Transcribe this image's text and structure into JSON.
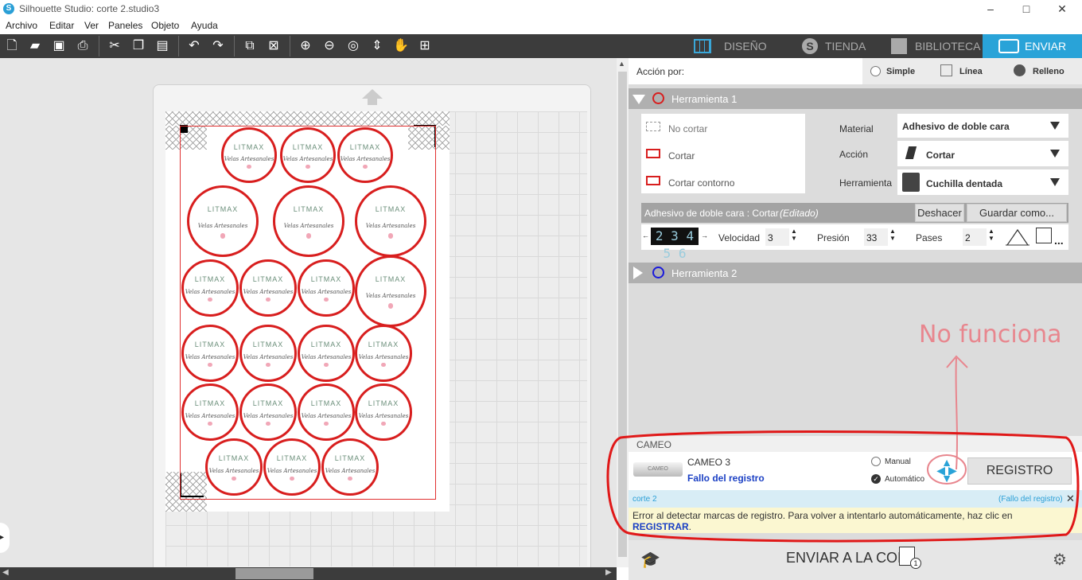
{
  "window": {
    "title": "Silhouette Studio: corte 2.studio3",
    "minimize": "–",
    "maximize": "□",
    "close": "✕"
  },
  "menu": [
    "Archivo",
    "Editar",
    "Ver",
    "Paneles",
    "Objeto",
    "Ayuda"
  ],
  "tabs": [
    {
      "label": "DISEÑO",
      "icon": "grid-icon"
    },
    {
      "label": "TIENDA",
      "icon": "store-icon"
    },
    {
      "label": "BIBLIOTECA",
      "icon": "library-icon"
    },
    {
      "label": "ENVIAR",
      "icon": "send-icon",
      "active": true
    }
  ],
  "accion": {
    "label": "Acción por:",
    "options": [
      "Simple",
      "Línea",
      "Relleno"
    ],
    "selected": "Simple"
  },
  "tool1": {
    "header": "Herramienta 1",
    "color": "#d81e1e",
    "cut_options": [
      "No cortar",
      "Cortar",
      "Cortar contorno"
    ],
    "material_label": "Material",
    "material_value": "Adhesivo de doble cara",
    "action_label": "Acción",
    "action_value": "Cortar",
    "tool_label": "Herramienta",
    "tool_value": "Cuchilla dentada",
    "preset_title": "Adhesivo de doble cara : Cortar",
    "preset_edited": "(Editado)",
    "undo_label": "Deshacer",
    "save_label": "Guardar como...",
    "blade_digits": "2 3 4 5 6",
    "speed_label": "Velocidad",
    "speed_value": "3",
    "pressure_label": "Presión",
    "pressure_value": "33",
    "passes_label": "Pases",
    "passes_value": "2",
    "more": "..."
  },
  "tool2": {
    "header": "Herramienta 2",
    "color": "#1a1adb"
  },
  "annotation": {
    "text": "No funciona",
    "color": "#e8868e"
  },
  "device": {
    "section": "CAMEO",
    "name": "CAMEO 3",
    "status": "Fallo del registro",
    "manual": "Manual",
    "auto": "Automático",
    "register_label": "REGISTRO",
    "device_label": "CAMEO"
  },
  "job": {
    "name": "corte 2",
    "status": "(Fallo del registro)",
    "close": "✕"
  },
  "error": {
    "text": "Error al detectar marcas de registro. Para volver a intentarlo automáticamente, haz clic en ",
    "link": "REGISTRAR",
    "end": "."
  },
  "send": {
    "label": "ENVIAR A LA COLA",
    "badge": "1"
  },
  "design": {
    "logo": "LITMAX",
    "sub": "Velas Artesanales"
  }
}
